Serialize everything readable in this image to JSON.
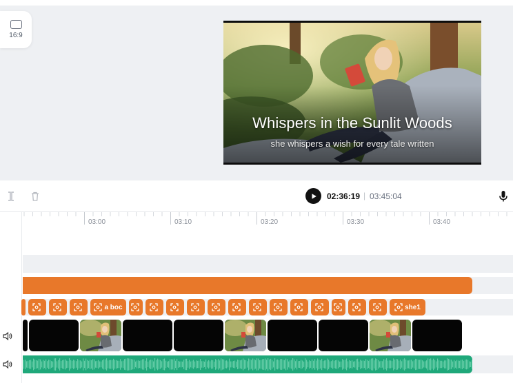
{
  "aspect_ratio": {
    "label": "16:9"
  },
  "preview": {
    "title": "Whispers in the Sunlit Woods",
    "subtitle": "she whispers a wish for every tale written"
  },
  "controls": {
    "current_time": "02:36:19",
    "separator": "|",
    "total_time": "03:45:04"
  },
  "ruler": {
    "labels": [
      "03:00",
      "03:10",
      "03:20",
      "03:30",
      "03:40"
    ]
  },
  "caption_chips": [
    {
      "text": ""
    },
    {
      "text": ""
    },
    {
      "text": ""
    },
    {
      "text": ""
    },
    {
      "text": "a boc"
    },
    {
      "text": ""
    },
    {
      "text": ""
    },
    {
      "text": ""
    },
    {
      "text": ""
    },
    {
      "text": ""
    },
    {
      "text": ""
    },
    {
      "text": ""
    },
    {
      "text": ""
    },
    {
      "text": ""
    },
    {
      "text": ""
    },
    {
      "text": ""
    },
    {
      "text": ""
    },
    {
      "text": ""
    },
    {
      "text": "she1"
    }
  ],
  "clips": [
    "black",
    "black",
    "image",
    "black",
    "black",
    "image",
    "black",
    "black",
    "image",
    "black"
  ],
  "icons": {
    "split": "split-icon",
    "delete": "trash-icon",
    "play": "play-icon",
    "mic": "microphone-icon",
    "volume": "volume-icon"
  },
  "colors": {
    "accent": "#e8782a",
    "audio": "#1fa87a"
  }
}
